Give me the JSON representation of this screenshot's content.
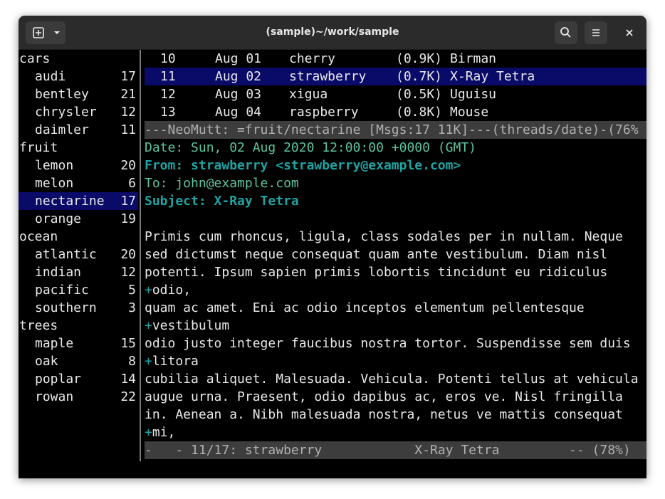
{
  "window": {
    "title": "(sample)~/work/sample"
  },
  "sidebar": [
    {
      "name": "cars",
      "count": "",
      "indent": false
    },
    {
      "name": "audi",
      "count": "17",
      "indent": true
    },
    {
      "name": "bentley",
      "count": "21",
      "indent": true
    },
    {
      "name": "chrysler",
      "count": "12",
      "indent": true
    },
    {
      "name": "daimler",
      "count": "11",
      "indent": true
    },
    {
      "name": "fruit",
      "count": "",
      "indent": false
    },
    {
      "name": "lemon",
      "count": "20",
      "indent": true
    },
    {
      "name": "melon",
      "count": "6",
      "indent": true
    },
    {
      "name": "nectarine",
      "count": "17",
      "indent": true,
      "selected": true
    },
    {
      "name": "orange",
      "count": "19",
      "indent": true
    },
    {
      "name": "ocean",
      "count": "",
      "indent": false
    },
    {
      "name": "atlantic",
      "count": "20",
      "indent": true
    },
    {
      "name": "indian",
      "count": "12",
      "indent": true
    },
    {
      "name": "pacific",
      "count": "5",
      "indent": true
    },
    {
      "name": "southern",
      "count": "3",
      "indent": true
    },
    {
      "name": "trees",
      "count": "",
      "indent": false
    },
    {
      "name": "maple",
      "count": "15",
      "indent": true
    },
    {
      "name": "oak",
      "count": "8",
      "indent": true
    },
    {
      "name": "poplar",
      "count": "14",
      "indent": true
    },
    {
      "name": "rowan",
      "count": "22",
      "indent": true
    }
  ],
  "index": [
    {
      "num": "10",
      "date": "Aug 01",
      "subject": "cherry",
      "size": "(0.9K)",
      "from": "Birman"
    },
    {
      "num": "11",
      "date": "Aug 02",
      "subject": "strawberry",
      "size": "(0.7K)",
      "from": "X-Ray Tetra",
      "selected": true
    },
    {
      "num": "12",
      "date": "Aug 03",
      "subject": "xigua",
      "size": "(0.5K)",
      "from": "Uguisu"
    },
    {
      "num": "13",
      "date": "Aug 04",
      "subject": "raspberry",
      "size": "(0.8K)",
      "from": "Mouse"
    }
  ],
  "index_status": "---NeoMutt: =fruit/nectarine [Msgs:17 11K]---(threads/date)-(76%",
  "headers": {
    "date": "Date: Sun, 02 Aug 2020 12:00:00 +0000 (GMT)",
    "from": "From: strawberry <strawberry@example.com>",
    "to": "To: john@example.com",
    "subject": "Subject: X-Ray Tetra"
  },
  "body": [
    {
      "plus": "",
      "text": "Primis cum rhoncus, ligula, class sodales per in nullam. Neque"
    },
    {
      "plus": "",
      "text": "sed dictumst neque consequat quam ante vestibulum. Diam nisl"
    },
    {
      "plus": "",
      "text": "potenti. Ipsum sapien primis lobortis tincidunt eu ridiculus"
    },
    {
      "plus": "+",
      "text": "odio,"
    },
    {
      "plus": "",
      "text": "quam ac amet. Eni ac odio inceptos elementum pellentesque"
    },
    {
      "plus": "+",
      "text": "vestibulum"
    },
    {
      "plus": "",
      "text": "odio justo integer faucibus nostra tortor. Suspendisse sem duis"
    },
    {
      "plus": "+",
      "text": "litora"
    },
    {
      "plus": "",
      "text": "cubilia aliquet. Malesuada. Vehicula. Potenti tellus at vehicula"
    },
    {
      "plus": "",
      "text": "augue urna. Praesent, odio dapibus ac, eros ve. Nisl fringilla"
    },
    {
      "plus": "",
      "text": "in. Aenean a. Nibh malesuada nostra, netus ve mattis consequat"
    },
    {
      "plus": "+",
      "text": "mi,"
    }
  ],
  "pager_status": "-   - 11/17: strawberry            X-Ray Tetra         -- (78%)",
  "icons": {
    "new_tab": "new-tab-icon",
    "dropdown": "chevron-down-icon",
    "search": "search-icon",
    "menu": "hamburger-menu-icon",
    "close": "close-icon"
  },
  "colors": {
    "selection": "#0a0a68",
    "header_green": "#5dc4a0",
    "header_teal": "#1fa3a3",
    "status_bg": "#3d3d3d"
  }
}
